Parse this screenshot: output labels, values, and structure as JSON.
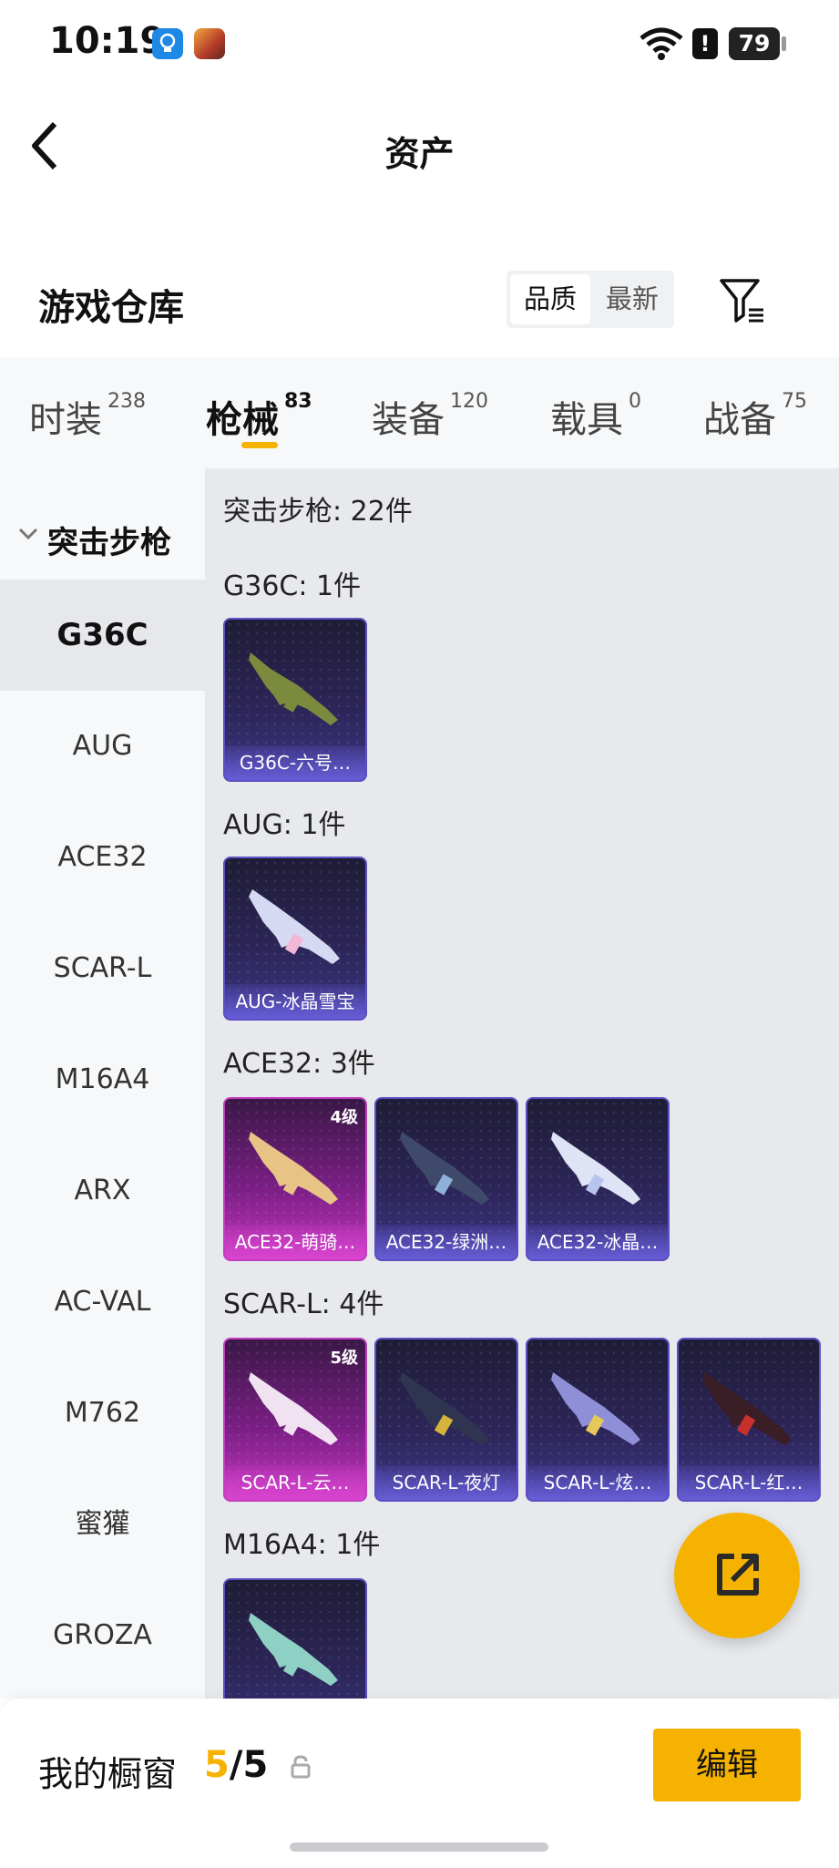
{
  "status_bar": {
    "time": "10:19",
    "battery": "79",
    "battery_level": 0.79,
    "icons": [
      "lightbulb-app-icon",
      "game-app-icon",
      "wifi-icon",
      "alert-icon",
      "battery-icon"
    ]
  },
  "header": {
    "title": "资产",
    "back_icon": "chevron-left-icon"
  },
  "warehouse": {
    "title": "游戏仓库",
    "sort_options": [
      "品质",
      "最新"
    ],
    "sort_selected": "品质",
    "filter_icon": "filter-icon"
  },
  "tabs": [
    {
      "label": "时装",
      "count": "238"
    },
    {
      "label": "枪械",
      "count": "83"
    },
    {
      "label": "装备",
      "count": "120"
    },
    {
      "label": "载具",
      "count": "0"
    },
    {
      "label": "战备",
      "count": "75"
    }
  ],
  "active_tab": "枪械",
  "sidebar": {
    "group_label": "突击步枪",
    "items": [
      "G36C",
      "AUG",
      "ACE32",
      "SCAR-L",
      "M16A4",
      "ARX",
      "AC-VAL",
      "M762",
      "蜜獾",
      "GROZA"
    ],
    "selected": "G36C"
  },
  "content": {
    "summary": "突击步枪: 22件",
    "sections": [
      {
        "title": "G36C: 1件",
        "items": [
          {
            "name": "G36C-六号…",
            "level": ""
          }
        ]
      },
      {
        "title": "AUG: 1件",
        "items": [
          {
            "name": "AUG-冰晶雪宝",
            "level": ""
          }
        ]
      },
      {
        "title": "ACE32: 3件",
        "items": [
          {
            "name": "ACE32-萌骑…",
            "level": "4级"
          },
          {
            "name": "ACE32-绿洲…",
            "level": ""
          },
          {
            "name": "ACE32-冰晶…",
            "level": ""
          }
        ]
      },
      {
        "title": "SCAR-L: 4件",
        "items": [
          {
            "name": "SCAR-L-云…",
            "level": "5级"
          },
          {
            "name": "SCAR-L-夜灯",
            "level": ""
          },
          {
            "name": "SCAR-L-炫…",
            "level": ""
          },
          {
            "name": "SCAR-L-红…",
            "level": ""
          }
        ]
      },
      {
        "title": "M16A4: 1件",
        "items": [
          {
            "name": "",
            "level": ""
          }
        ]
      }
    ]
  },
  "fab": {
    "icon": "share-external-icon"
  },
  "showcase": {
    "label": "我的橱窗",
    "current": "5",
    "separator": "/",
    "max": "5",
    "lock_icon": "lock-icon",
    "edit_label": "编辑"
  },
  "colors": {
    "accent": "#f6b200",
    "purple_card_border": "#5b4fc4",
    "pink_card_border": "#c23cc0"
  }
}
